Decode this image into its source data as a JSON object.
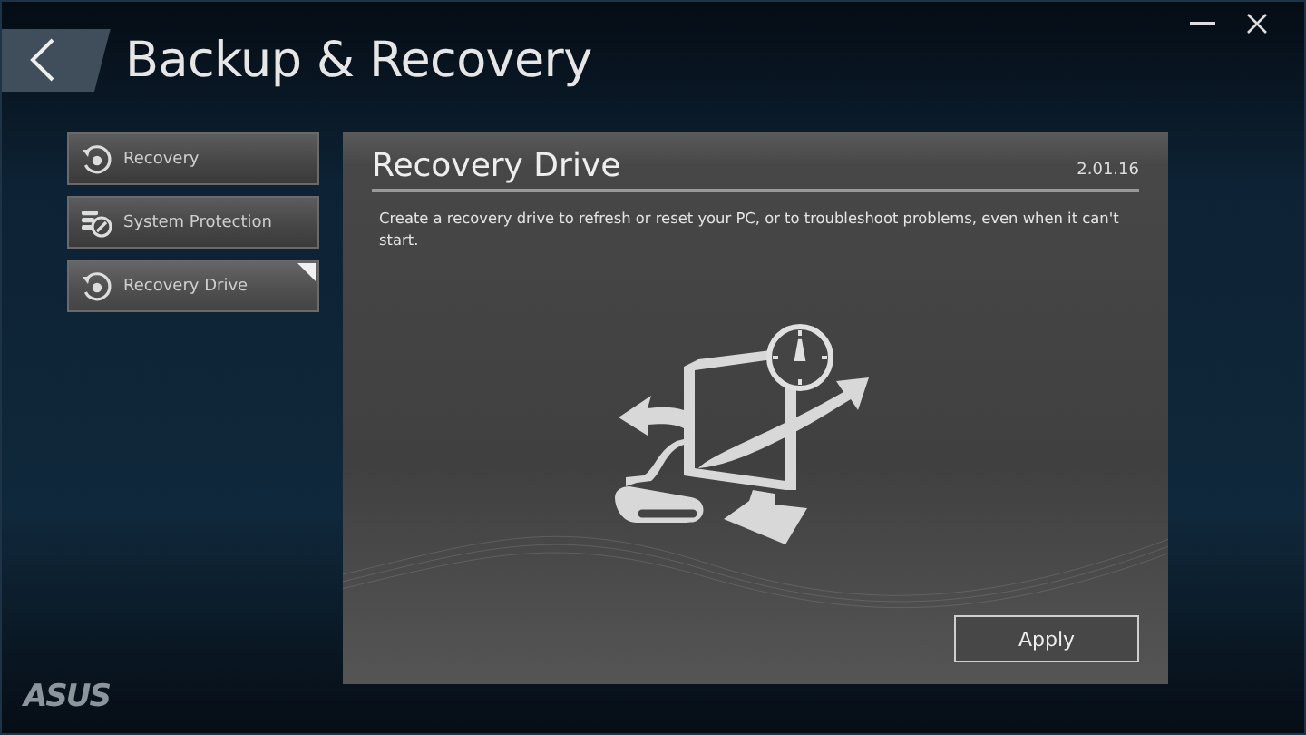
{
  "window": {
    "title": "Backup & Recovery"
  },
  "sidebar": {
    "items": [
      {
        "label": "Recovery",
        "kind": "restore",
        "selected": false
      },
      {
        "label": "System Protection",
        "kind": "protection",
        "selected": false
      },
      {
        "label": "Recovery Drive",
        "kind": "restore",
        "selected": true
      }
    ]
  },
  "panel": {
    "title": "Recovery Drive",
    "version": "2.01.16",
    "description": "Create a recovery drive to refresh or reset your PC, or to troubleshoot problems, even when it can't start.",
    "button": "Apply"
  },
  "footer": {
    "logo": "ASUS"
  }
}
